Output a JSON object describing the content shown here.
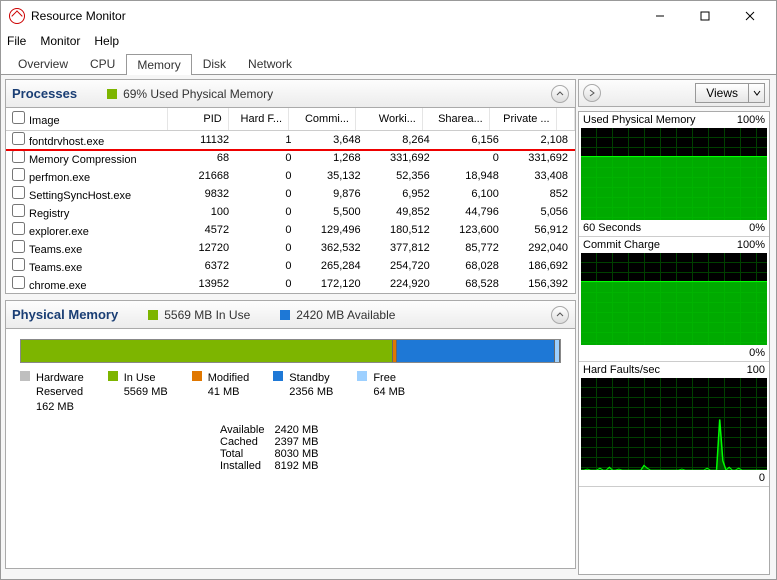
{
  "window": {
    "title": "Resource Monitor"
  },
  "menu": {
    "file": "File",
    "monitor": "Monitor",
    "help": "Help"
  },
  "tabs": {
    "overview": "Overview",
    "cpu": "CPU",
    "memory": "Memory",
    "disk": "Disk",
    "network": "Network"
  },
  "procPanel": {
    "title": "Processes",
    "sub": "69% Used Physical Memory",
    "cols": {
      "image": "Image",
      "pid": "PID",
      "hardf": "Hard F...",
      "commit": "Commi...",
      "working": "Worki...",
      "sharea": "Sharea...",
      "private": "Private ..."
    },
    "rows": [
      {
        "image": "fontdrvhost.exe",
        "pid": "11132",
        "hf": "1",
        "commit": "3,648",
        "ws": "8,264",
        "sh": "6,156",
        "pv": "2,108"
      },
      {
        "image": "Memory Compression",
        "pid": "68",
        "hf": "0",
        "commit": "1,268",
        "ws": "331,692",
        "sh": "0",
        "pv": "331,692"
      },
      {
        "image": "perfmon.exe",
        "pid": "21668",
        "hf": "0",
        "commit": "35,132",
        "ws": "52,356",
        "sh": "18,948",
        "pv": "33,408"
      },
      {
        "image": "SettingSyncHost.exe",
        "pid": "9832",
        "hf": "0",
        "commit": "9,876",
        "ws": "6,952",
        "sh": "6,100",
        "pv": "852"
      },
      {
        "image": "Registry",
        "pid": "100",
        "hf": "0",
        "commit": "5,500",
        "ws": "49,852",
        "sh": "44,796",
        "pv": "5,056"
      },
      {
        "image": "explorer.exe",
        "pid": "4572",
        "hf": "0",
        "commit": "129,496",
        "ws": "180,512",
        "sh": "123,600",
        "pv": "56,912"
      },
      {
        "image": "Teams.exe",
        "pid": "12720",
        "hf": "0",
        "commit": "362,532",
        "ws": "377,812",
        "sh": "85,772",
        "pv": "292,040"
      },
      {
        "image": "Teams.exe",
        "pid": "6372",
        "hf": "0",
        "commit": "265,284",
        "ws": "254,720",
        "sh": "68,028",
        "pv": "186,692"
      },
      {
        "image": "chrome.exe",
        "pid": "13952",
        "hf": "0",
        "commit": "172,120",
        "ws": "224,920",
        "sh": "68,528",
        "pv": "156,392"
      }
    ]
  },
  "physPanel": {
    "title": "Physical Memory",
    "inuse": "5569 MB In Use",
    "avail": "2420 MB Available",
    "legend": {
      "hw": {
        "label": "Hardware",
        "sub": "Reserved",
        "val": "162 MB"
      },
      "in": {
        "label": "In Use",
        "val": "5569 MB"
      },
      "mod": {
        "label": "Modified",
        "val": "41 MB"
      },
      "sb": {
        "label": "Standby",
        "val": "2356 MB"
      },
      "fr": {
        "label": "Free",
        "val": "64 MB"
      }
    },
    "stats": {
      "availableL": "Available",
      "availableV": "2420 MB",
      "cachedL": "Cached",
      "cachedV": "2397 MB",
      "totalL": "Total",
      "totalV": "8030 MB",
      "installedL": "Installed",
      "installedV": "8192 MB"
    }
  },
  "side": {
    "views": "Views",
    "g1": {
      "title": "Used Physical Memory",
      "max": "100%",
      "xleft": "60 Seconds",
      "xright": "0%"
    },
    "g2": {
      "title": "Commit Charge",
      "max": "100%",
      "xright": "0%"
    },
    "g3": {
      "title": "Hard Faults/sec",
      "max": "100",
      "xright": "0"
    }
  },
  "colors": {
    "inuse": "#7db500",
    "modified": "#e07700",
    "standby": "#1e78d6",
    "free": "#9dd0ff",
    "hw": "#bfbfbf"
  },
  "chart_data": {
    "used_physical_memory": {
      "type": "area",
      "title": "Used Physical Memory",
      "x_range_seconds": 60,
      "ylim": [
        0,
        100
      ],
      "ylabel": "%",
      "approx_value": 69,
      "series": [
        {
          "name": "Used %",
          "values": [
            69,
            69,
            69,
            69,
            69,
            69,
            69,
            69,
            69,
            69,
            69,
            69
          ]
        }
      ]
    },
    "commit_charge": {
      "type": "area",
      "title": "Commit Charge",
      "x_range_seconds": 60,
      "ylim": [
        0,
        100
      ],
      "ylabel": "%",
      "approx_value": 68,
      "series": [
        {
          "name": "Commit %",
          "values": [
            68,
            68,
            68,
            68,
            68,
            68,
            68,
            68,
            68,
            68,
            68,
            68
          ]
        }
      ]
    },
    "hard_faults_per_sec": {
      "type": "line",
      "title": "Hard Faults/sec",
      "x_range_seconds": 60,
      "ylim": [
        0,
        100
      ],
      "series": [
        {
          "name": "Hard Faults/sec",
          "values": [
            0,
            0,
            1,
            0,
            0,
            0,
            2,
            0,
            0,
            3,
            0,
            0,
            1,
            0,
            0,
            0,
            0,
            0,
            0,
            0,
            5,
            2,
            0,
            0,
            0,
            0,
            0,
            0,
            0,
            0,
            0,
            0,
            1,
            0,
            0,
            0,
            0,
            0,
            0,
            0,
            2,
            0,
            0,
            0,
            55,
            10,
            0,
            3,
            0,
            0,
            2,
            0,
            0,
            0,
            0,
            0,
            0,
            0,
            0,
            0
          ]
        }
      ]
    },
    "memory_bar": {
      "type": "bar",
      "title": "Physical Memory",
      "categories": [
        "Hardware Reserved",
        "In Use",
        "Modified",
        "Standby",
        "Free"
      ],
      "values_mb": [
        162,
        5569,
        41,
        2356,
        64
      ],
      "total_installed_mb": 8192,
      "available_mb": 2420,
      "cached_mb": 2397,
      "total_usable_mb": 8030
    }
  }
}
